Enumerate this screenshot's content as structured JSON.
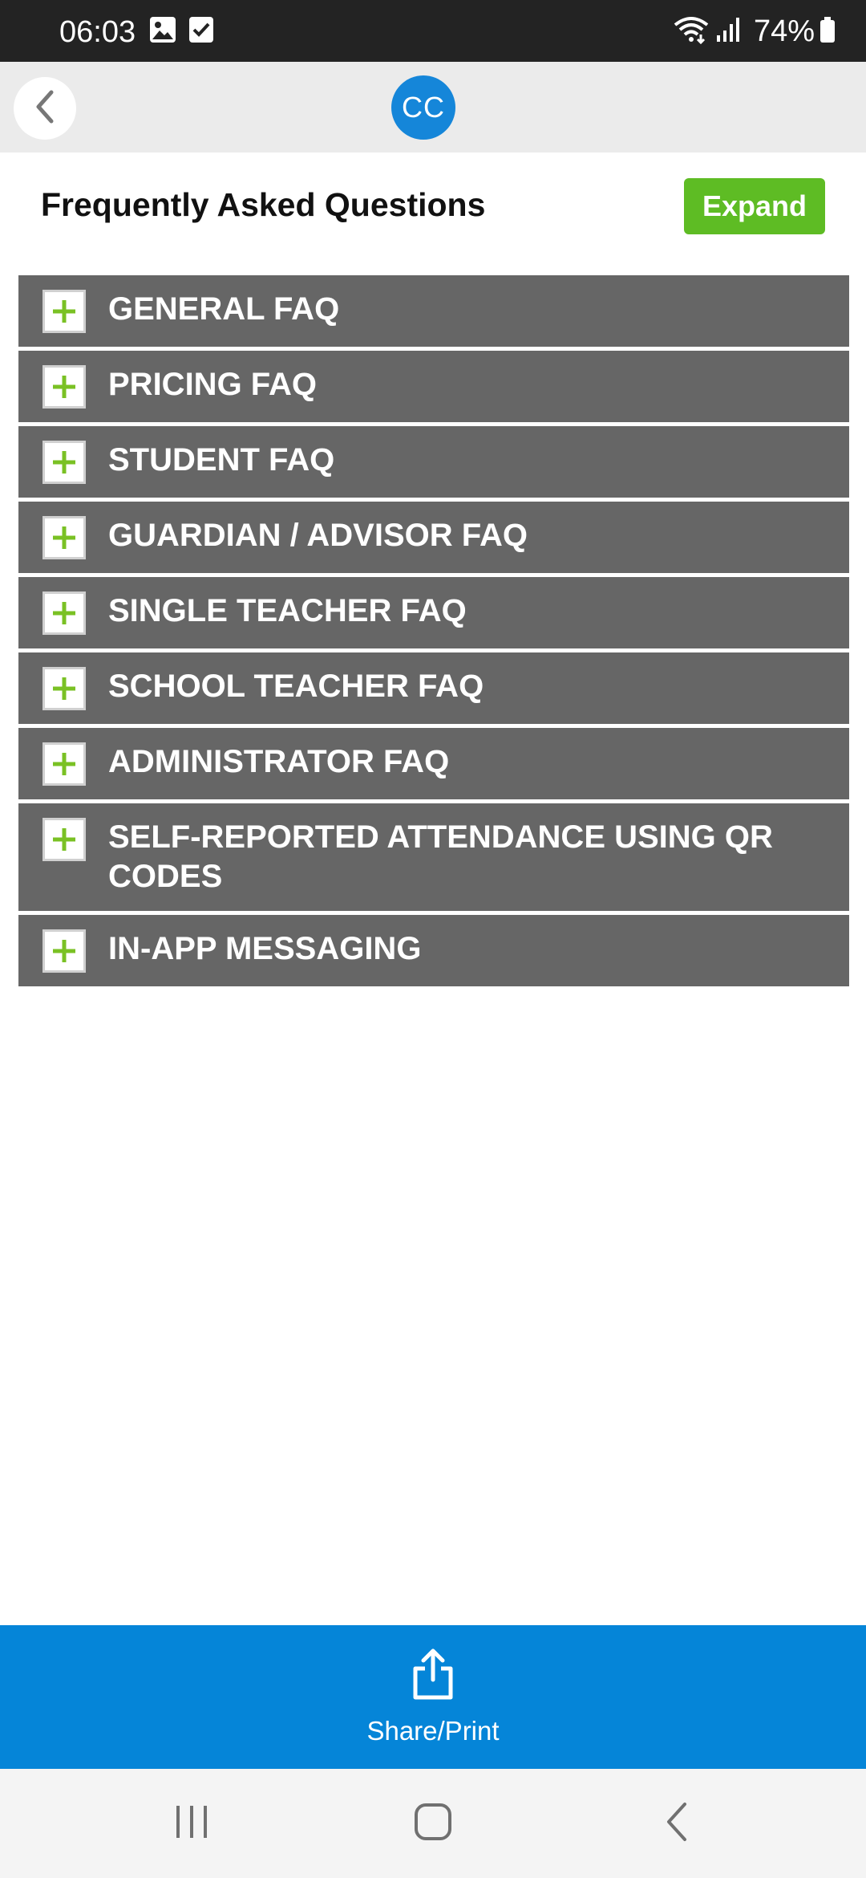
{
  "status_bar": {
    "time": "06:03",
    "battery": "74%",
    "left_icons": [
      "image-icon",
      "checkbox-icon"
    ],
    "right_icons": [
      "wifi-icon",
      "signal-icon",
      "battery-icon"
    ]
  },
  "app_bar": {
    "logo_text": "CC",
    "logo_color": "#1586d9"
  },
  "header": {
    "title": "Frequently Asked Questions",
    "expand_label": "Expand",
    "expand_color": "#5ebc24"
  },
  "faq": {
    "items": [
      {
        "label": "GENERAL FAQ"
      },
      {
        "label": "PRICING FAQ"
      },
      {
        "label": "STUDENT FAQ"
      },
      {
        "label": "GUARDIAN / ADVISOR FAQ"
      },
      {
        "label": "SINGLE TEACHER FAQ"
      },
      {
        "label": "SCHOOL TEACHER FAQ"
      },
      {
        "label": "ADMINISTRATOR FAQ"
      },
      {
        "label": "SELF-REPORTED ATTENDANCE USING QR CODES"
      },
      {
        "label": "IN-APP MESSAGING"
      }
    ],
    "accent_color": "#7ac124"
  },
  "share_bar": {
    "label": "Share/Print",
    "color": "#0585d8"
  },
  "nav_bar": {
    "icons": [
      "recent-apps-icon",
      "home-icon",
      "nav-back-icon"
    ]
  }
}
